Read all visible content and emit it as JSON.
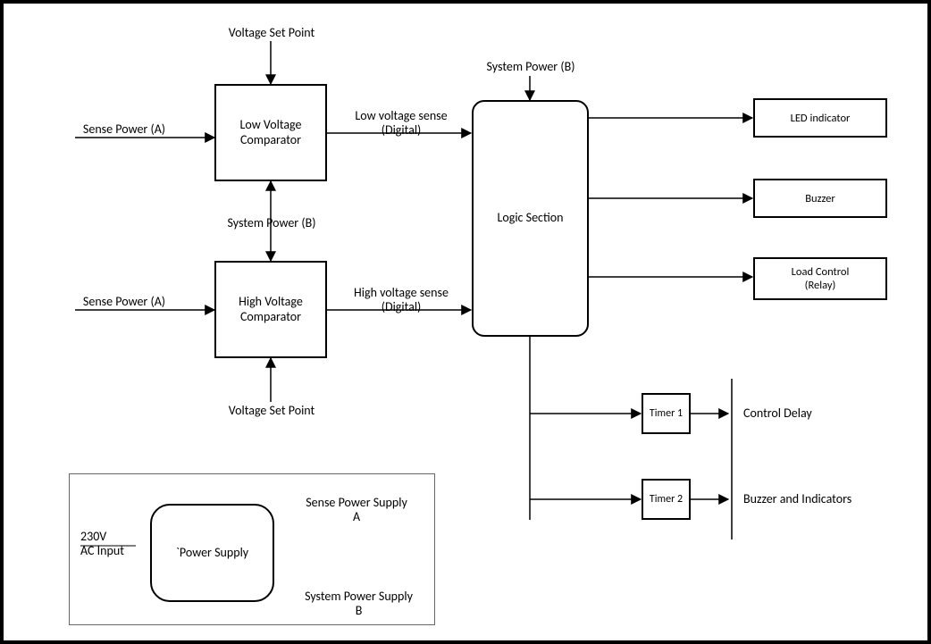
{
  "top_labels": {
    "voltage_set_point_top": "Voltage Set Point",
    "voltage_set_point_bottom": "Voltage Set Point",
    "system_power_b_top": "System Power (B)",
    "system_power_b_mid": "System Power (B)"
  },
  "left_inputs": {
    "sense_power_a1": "Sense Power (A)",
    "sense_power_a2": "Sense Power (A)"
  },
  "blocks": {
    "low_comp": "Low Voltage\nComparator",
    "high_comp": "High Voltage\nComparator",
    "logic": "Logic Section",
    "led": "LED indicator",
    "buzzer": "Buzzer",
    "load_control": "Load Control\n(Relay)",
    "timer1": "Timer 1",
    "timer2": "Timer 2",
    "power_supply": "`Power Supply"
  },
  "signals": {
    "low_sense": "Low voltage sense\n(Digital)",
    "high_sense": "High voltage sense\n(Digital)"
  },
  "timer_out": {
    "control_delay": "Control Delay",
    "buzz_ind": "Buzzer and Indicators"
  },
  "psu": {
    "input": "230V\nAC Input",
    "out_a": "Sense Power Supply\nA",
    "out_b": "System Power Supply\nB"
  }
}
